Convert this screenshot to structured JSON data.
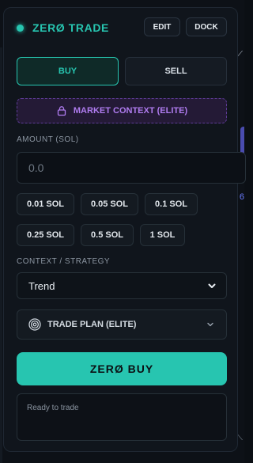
{
  "header": {
    "title": "ZERØ TRADE",
    "edit_label": "EDIT",
    "dock_label": "DOCK"
  },
  "side_tabs": {
    "buy_label": "BUY",
    "sell_label": "SELL",
    "selected": "BUY"
  },
  "market_context": {
    "label": "MARKET CONTEXT (ELITE)",
    "icon": "lock-icon"
  },
  "amount": {
    "label": "AMOUNT (SOL)",
    "placeholder": "0.0",
    "value": ""
  },
  "presets": [
    "0.01 SOL",
    "0.05 SOL",
    "0.1 SOL",
    "0.25 SOL",
    "0.5 SOL",
    "1 SOL"
  ],
  "strategy": {
    "label": "CONTEXT / STRATEGY",
    "selected": "Trend"
  },
  "trade_plan": {
    "label": "TRADE PLAN (ELITE)",
    "icon": "target-icon"
  },
  "buy_button": {
    "label": "ZERØ BUY"
  },
  "status": {
    "text": "Ready to trade"
  },
  "background": {
    "marks": [
      "6",
      "⟋",
      "⟍"
    ]
  },
  "colors": {
    "accent": "#27c5b0",
    "elite": "#b07cf0",
    "panel": "#10151c",
    "page": "#0b0f14"
  }
}
